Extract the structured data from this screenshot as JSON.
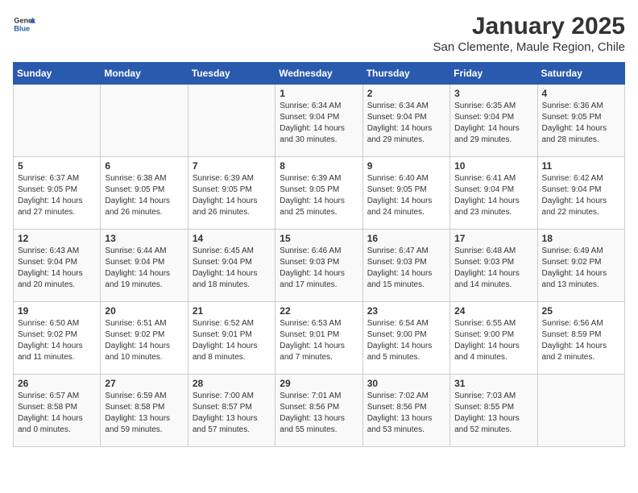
{
  "header": {
    "logo_general": "General",
    "logo_blue": "Blue",
    "title": "January 2025",
    "subtitle": "San Clemente, Maule Region, Chile"
  },
  "weekdays": [
    "Sunday",
    "Monday",
    "Tuesday",
    "Wednesday",
    "Thursday",
    "Friday",
    "Saturday"
  ],
  "weeks": [
    [
      {
        "day": "",
        "info": ""
      },
      {
        "day": "",
        "info": ""
      },
      {
        "day": "",
        "info": ""
      },
      {
        "day": "1",
        "info": "Sunrise: 6:34 AM\nSunset: 9:04 PM\nDaylight: 14 hours and 30 minutes."
      },
      {
        "day": "2",
        "info": "Sunrise: 6:34 AM\nSunset: 9:04 PM\nDaylight: 14 hours and 29 minutes."
      },
      {
        "day": "3",
        "info": "Sunrise: 6:35 AM\nSunset: 9:04 PM\nDaylight: 14 hours and 29 minutes."
      },
      {
        "day": "4",
        "info": "Sunrise: 6:36 AM\nSunset: 9:05 PM\nDaylight: 14 hours and 28 minutes."
      }
    ],
    [
      {
        "day": "5",
        "info": "Sunrise: 6:37 AM\nSunset: 9:05 PM\nDaylight: 14 hours and 27 minutes."
      },
      {
        "day": "6",
        "info": "Sunrise: 6:38 AM\nSunset: 9:05 PM\nDaylight: 14 hours and 26 minutes."
      },
      {
        "day": "7",
        "info": "Sunrise: 6:39 AM\nSunset: 9:05 PM\nDaylight: 14 hours and 26 minutes."
      },
      {
        "day": "8",
        "info": "Sunrise: 6:39 AM\nSunset: 9:05 PM\nDaylight: 14 hours and 25 minutes."
      },
      {
        "day": "9",
        "info": "Sunrise: 6:40 AM\nSunset: 9:05 PM\nDaylight: 14 hours and 24 minutes."
      },
      {
        "day": "10",
        "info": "Sunrise: 6:41 AM\nSunset: 9:04 PM\nDaylight: 14 hours and 23 minutes."
      },
      {
        "day": "11",
        "info": "Sunrise: 6:42 AM\nSunset: 9:04 PM\nDaylight: 14 hours and 22 minutes."
      }
    ],
    [
      {
        "day": "12",
        "info": "Sunrise: 6:43 AM\nSunset: 9:04 PM\nDaylight: 14 hours and 20 minutes."
      },
      {
        "day": "13",
        "info": "Sunrise: 6:44 AM\nSunset: 9:04 PM\nDaylight: 14 hours and 19 minutes."
      },
      {
        "day": "14",
        "info": "Sunrise: 6:45 AM\nSunset: 9:04 PM\nDaylight: 14 hours and 18 minutes."
      },
      {
        "day": "15",
        "info": "Sunrise: 6:46 AM\nSunset: 9:03 PM\nDaylight: 14 hours and 17 minutes."
      },
      {
        "day": "16",
        "info": "Sunrise: 6:47 AM\nSunset: 9:03 PM\nDaylight: 14 hours and 15 minutes."
      },
      {
        "day": "17",
        "info": "Sunrise: 6:48 AM\nSunset: 9:03 PM\nDaylight: 14 hours and 14 minutes."
      },
      {
        "day": "18",
        "info": "Sunrise: 6:49 AM\nSunset: 9:02 PM\nDaylight: 14 hours and 13 minutes."
      }
    ],
    [
      {
        "day": "19",
        "info": "Sunrise: 6:50 AM\nSunset: 9:02 PM\nDaylight: 14 hours and 11 minutes."
      },
      {
        "day": "20",
        "info": "Sunrise: 6:51 AM\nSunset: 9:02 PM\nDaylight: 14 hours and 10 minutes."
      },
      {
        "day": "21",
        "info": "Sunrise: 6:52 AM\nSunset: 9:01 PM\nDaylight: 14 hours and 8 minutes."
      },
      {
        "day": "22",
        "info": "Sunrise: 6:53 AM\nSunset: 9:01 PM\nDaylight: 14 hours and 7 minutes."
      },
      {
        "day": "23",
        "info": "Sunrise: 6:54 AM\nSunset: 9:00 PM\nDaylight: 14 hours and 5 minutes."
      },
      {
        "day": "24",
        "info": "Sunrise: 6:55 AM\nSunset: 9:00 PM\nDaylight: 14 hours and 4 minutes."
      },
      {
        "day": "25",
        "info": "Sunrise: 6:56 AM\nSunset: 8:59 PM\nDaylight: 14 hours and 2 minutes."
      }
    ],
    [
      {
        "day": "26",
        "info": "Sunrise: 6:57 AM\nSunset: 8:58 PM\nDaylight: 14 hours and 0 minutes."
      },
      {
        "day": "27",
        "info": "Sunrise: 6:59 AM\nSunset: 8:58 PM\nDaylight: 13 hours and 59 minutes."
      },
      {
        "day": "28",
        "info": "Sunrise: 7:00 AM\nSunset: 8:57 PM\nDaylight: 13 hours and 57 minutes."
      },
      {
        "day": "29",
        "info": "Sunrise: 7:01 AM\nSunset: 8:56 PM\nDaylight: 13 hours and 55 minutes."
      },
      {
        "day": "30",
        "info": "Sunrise: 7:02 AM\nSunset: 8:56 PM\nDaylight: 13 hours and 53 minutes."
      },
      {
        "day": "31",
        "info": "Sunrise: 7:03 AM\nSunset: 8:55 PM\nDaylight: 13 hours and 52 minutes."
      },
      {
        "day": "",
        "info": ""
      }
    ]
  ]
}
